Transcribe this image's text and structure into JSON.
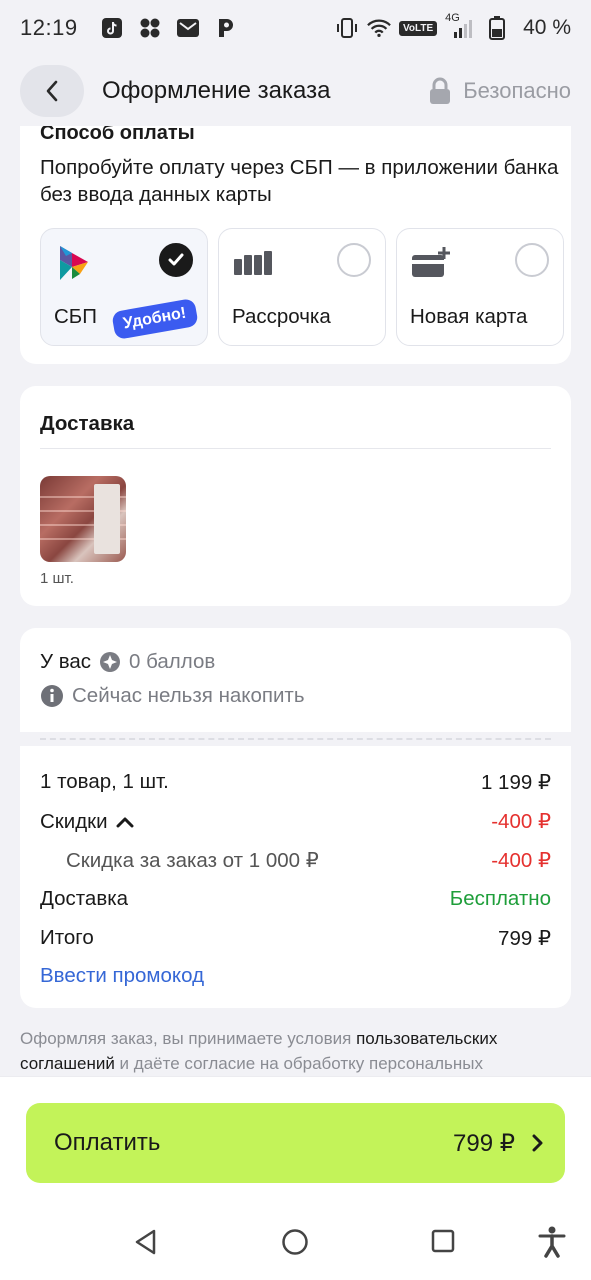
{
  "status_bar": {
    "time": "12:19",
    "network": "4G",
    "volte": "VoLTE",
    "battery": "40 %"
  },
  "header": {
    "title": "Оформление заказа",
    "secure_label": "Безопасно"
  },
  "payment": {
    "title": "Способ оплаты",
    "hint": "Попробуйте оплату через СБП — в приложении банка без ввода данных карты",
    "options": [
      {
        "label": "СБП",
        "selected": true,
        "badge": "Удобно!"
      },
      {
        "label": "Рассрочка",
        "selected": false
      },
      {
        "label": "Новая карта",
        "selected": false
      }
    ]
  },
  "delivery": {
    "title": "Доставка",
    "quantity": "1 шт."
  },
  "bonus": {
    "prefix": "У вас",
    "points": "0 баллов",
    "info": "Сейчас нельзя накопить"
  },
  "summary": {
    "items_label": "1 товар, 1 шт.",
    "items_value": "1 199 ₽",
    "discounts_label": "Скидки",
    "discounts_value": "-400 ₽",
    "discount_sub_label": "Скидка за заказ от 1 000 ₽",
    "discount_sub_value": "-400 ₽",
    "delivery_label": "Доставка",
    "delivery_value": "Бесплатно",
    "total_label": "Итого",
    "total_value": "799 ₽",
    "promo_link": "Ввести промокод"
  },
  "terms": {
    "part1": "Оформляя заказ, вы принимаете условия ",
    "link": "пользовательских соглашений",
    "part2": " и даёте согласие на обработку персональных"
  },
  "pay_button": {
    "label": "Оплатить",
    "amount": "799 ₽"
  },
  "colors": {
    "accent_green": "#c3f359",
    "discount_red": "#e5312f",
    "free_green": "#1e9e3a",
    "link_blue": "#3567d6",
    "badge_blue": "#3b5bf0"
  }
}
